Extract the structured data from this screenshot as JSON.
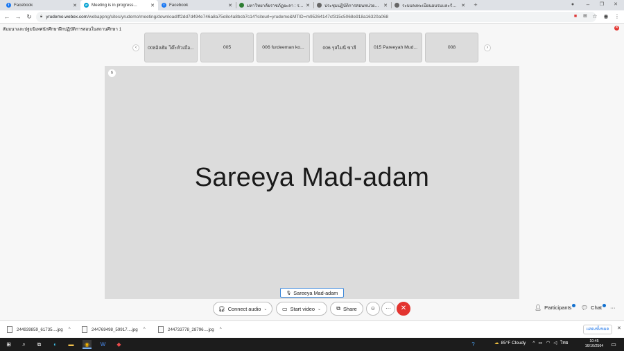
{
  "browser": {
    "tabs": [
      {
        "title": "Facebook",
        "icon_color": "#1877f2",
        "active": false
      },
      {
        "title": "Meeting is in progress...",
        "icon_color": "#00a0d1",
        "active": true
      },
      {
        "title": "Facebook",
        "icon_color": "#1877f2",
        "active": false
      },
      {
        "title": "มหาวิทยาลัยราชภัฏยะลา : ระบบสอบฯ...",
        "icon_color": "#2e7d32",
        "active": false
      },
      {
        "title": "ประชุมปฏิบัติการสอนหน่วยวิทยาการ โครง...",
        "icon_color": "#666666",
        "active": false
      },
      {
        "title": "ระบบลงทะเบียนอบรมและรับเกียรติบัตร...",
        "icon_color": "#666666",
        "active": false
      }
    ],
    "new_tab": "+",
    "url_host": "yrudemo.webex.com",
    "url_rest": "/webappng/sites/yrudemo/meeting/download/ff2dd7d494e746a8a75e8c4a8bcb7c14?siteurl=yrudemo&MTID=m95264147cf315c5068e918a16320a068"
  },
  "meeting": {
    "title": "สัมมนาและปฐมนิเทศนักศึกษาฝึกปฏิบัติการสอนในสถานศึกษา 1",
    "close_glyph": "✕",
    "thumbnails": [
      "008อิลฮัม โต๊ะหัวเมือ...",
      "005",
      "006 furdeeman ko...",
      "006 รุสไมนี ซาลี",
      "015 Pareeyah Mud...",
      "008"
    ],
    "stage_badge": "ธ",
    "active_speaker": "Sareeya Mad-adam",
    "name_tag": "Sareeya Mad-adam",
    "controls": {
      "connect_audio": "Connect audio",
      "start_video": "Start video",
      "share": "Share",
      "more": "···",
      "leave": "✕",
      "participants": "Participants",
      "chat": "Chat",
      "overflow": "···"
    },
    "accent": "#1170cf",
    "leave_color": "#e3342f"
  },
  "downloads": {
    "items": [
      "244939859_61735....jpg",
      "244769498_59917....jpg",
      "244733778_28796....jpg"
    ],
    "show_all": "แสดงทั้งหมด",
    "close": "✕"
  },
  "taskbar": {
    "weather": "85°F Cloudy",
    "lang": "ไทย",
    "time": "10:45",
    "date": "16/10/2564"
  }
}
